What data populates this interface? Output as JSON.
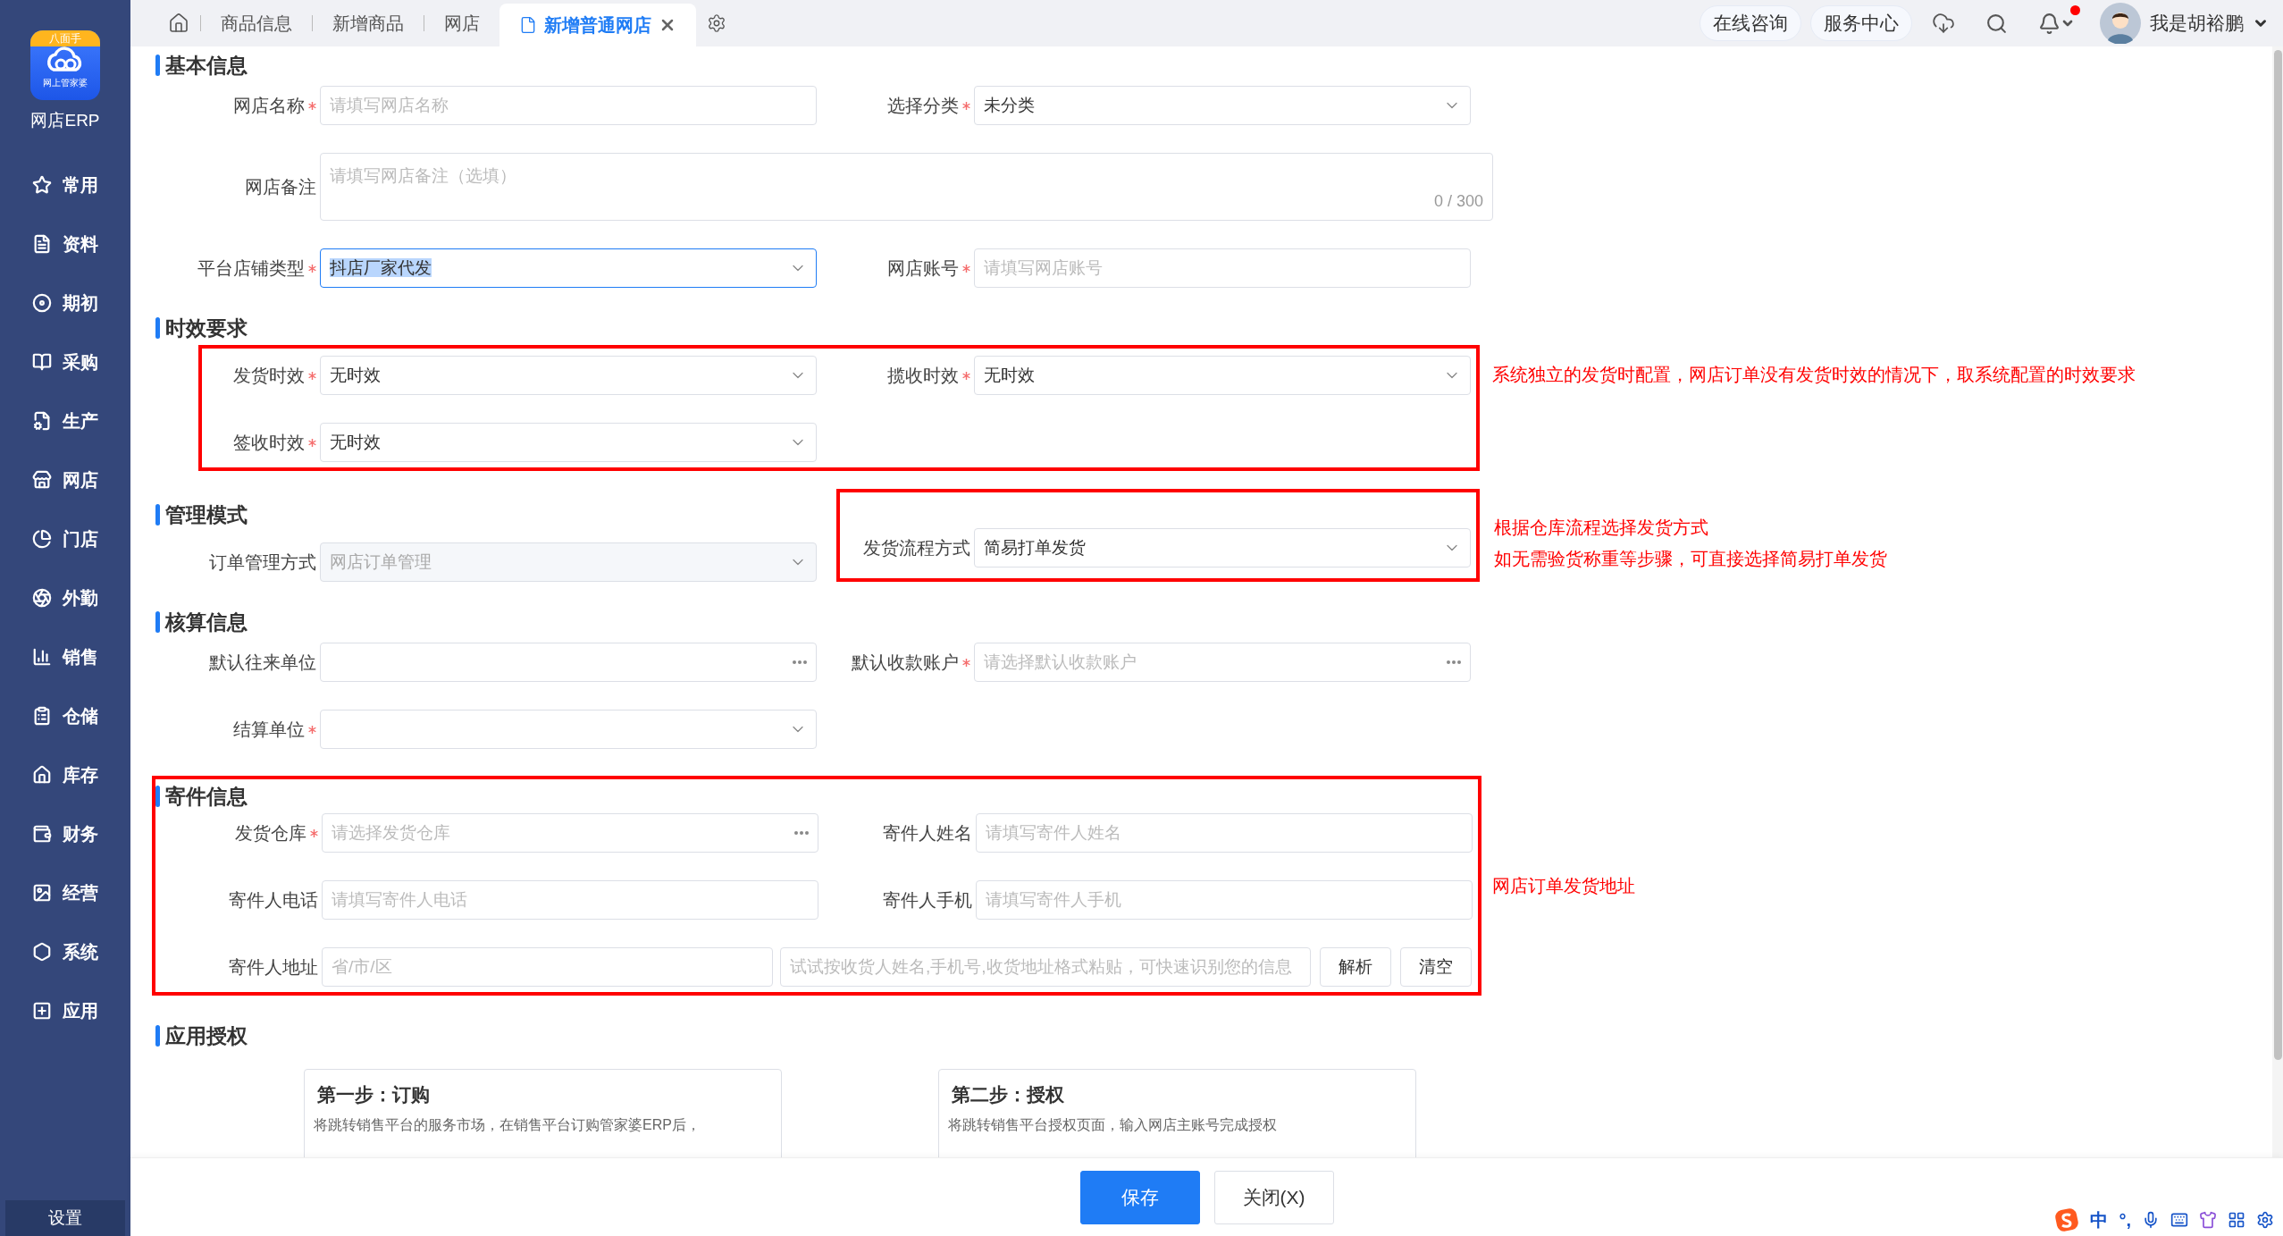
{
  "sidebar": {
    "logo": {
      "badge": "八面手",
      "caption": "网上管家婆"
    },
    "app_name": "网店ERP",
    "items": [
      {
        "label": "常用"
      },
      {
        "label": "资料"
      },
      {
        "label": "期初"
      },
      {
        "label": "采购"
      },
      {
        "label": "生产"
      },
      {
        "label": "网店"
      },
      {
        "label": "门店"
      },
      {
        "label": "外勤"
      },
      {
        "label": "销售"
      },
      {
        "label": "仓储"
      },
      {
        "label": "库存"
      },
      {
        "label": "财务"
      },
      {
        "label": "经营"
      },
      {
        "label": "系统"
      },
      {
        "label": "应用"
      }
    ],
    "footer": "设置"
  },
  "topbar": {
    "tabs": [
      {
        "label": "商品信息",
        "selected": false
      },
      {
        "label": "新增商品",
        "selected": false
      },
      {
        "label": "网店",
        "selected": false
      },
      {
        "label": "新增普通网店",
        "selected": true
      }
    ],
    "links": [
      "在线咨询",
      "服务中心"
    ],
    "has_unread": true,
    "user": "我是胡裕鹏"
  },
  "sections": [
    {
      "kind": "form",
      "title": "基本信息",
      "rows": [
        {
          "fields": [
            {
              "label": "网店名称",
              "required": true,
              "kind": "input",
              "placeholder": "请填写网店名称"
            },
            {
              "label": "选择分类",
              "required": true,
              "kind": "select",
              "value": "未分类"
            }
          ]
        },
        {
          "fields": [
            {
              "label": "网店备注",
              "required": false,
              "kind": "textarea",
              "placeholder": "请填写网店备注（选填）",
              "counter": "0 / 300"
            }
          ]
        },
        {
          "fields": [
            {
              "label": "平台店铺类型",
              "required": true,
              "kind": "select",
              "value": "抖店厂家代发",
              "focused": true
            },
            {
              "label": "网店账号",
              "required": true,
              "kind": "input",
              "placeholder": "请填写网店账号"
            }
          ]
        }
      ]
    },
    {
      "kind": "framed_rows",
      "title": "时效要求",
      "note": [
        "系统独立的发货时配置，网店订单没有发货时效的情况下，取系统配置的时效要求"
      ],
      "rows": [
        {
          "fields": [
            {
              "label": "发货时效",
              "required": true,
              "kind": "select",
              "value": "无时效"
            },
            {
              "label": "揽收时效",
              "required": true,
              "kind": "select",
              "value": "无时效"
            }
          ]
        },
        {
          "fields": [
            {
              "label": "签收时效",
              "required": true,
              "kind": "select",
              "value": "无时效"
            }
          ]
        }
      ]
    },
    {
      "kind": "framed_right",
      "title": "管理模式",
      "note": [
        "根据仓库流程选择发货方式",
        "如无需验货称重等步骤，可直接选择简易打单发货"
      ],
      "rows": [
        {
          "fields": [
            {
              "label": "订单管理方式",
              "required": false,
              "kind": "select",
              "value": "网店订单管理",
              "disabled": true
            },
            {
              "label": "发货流程方式",
              "required": false,
              "kind": "select",
              "value": "简易打单发货"
            }
          ]
        }
      ]
    },
    {
      "kind": "form",
      "title": "核算信息",
      "rows": [
        {
          "fields": [
            {
              "label": "默认往来单位",
              "required": false,
              "kind": "picker"
            },
            {
              "label": "默认收款账户",
              "required": true,
              "kind": "picker",
              "placeholder": "请选择默认收款账户"
            }
          ]
        },
        {
          "fields": [
            {
              "label": "结算单位",
              "required": true,
              "kind": "select"
            }
          ]
        }
      ]
    },
    {
      "kind": "framed_section",
      "title": "寄件信息",
      "note": [
        "网店订单发货地址"
      ],
      "rows": [
        {
          "fields": [
            {
              "label": "发货仓库",
              "required": true,
              "kind": "picker",
              "placeholder": "请选择发货仓库"
            },
            {
              "label": "寄件人姓名",
              "required": false,
              "kind": "input",
              "placeholder": "请填写寄件人姓名"
            }
          ]
        },
        {
          "fields": [
            {
              "label": "寄件人电话",
              "required": false,
              "kind": "input",
              "placeholder": "请填写寄件人电话"
            },
            {
              "label": "寄件人手机",
              "required": false,
              "kind": "input",
              "placeholder": "请填写寄件人手机"
            }
          ]
        },
        {
          "fields": [
            {
              "label": "寄件人地址",
              "required": false,
              "kind": "address",
              "region_placeholder": "省/市/区",
              "placeholder": "试试按收货人姓名,手机号,收货地址格式粘贴，可快速识别您的信息",
              "buttons": [
                "解析",
                "清空"
              ]
            }
          ]
        }
      ]
    },
    {
      "kind": "cards",
      "title": "应用授权",
      "cards": [
        {
          "title": "第一步：订购",
          "text": "将跳转销售平台的服务市场，在销售平台订购管家婆ERP后，"
        },
        {
          "title": "第二步：授权",
          "text": "将跳转销售平台授权页面，输入网店主账号完成授权"
        }
      ]
    }
  ],
  "footer": {
    "buttons": [
      {
        "label": "保存",
        "kind": "primary"
      },
      {
        "label": "关闭(X)",
        "kind": "default"
      }
    ]
  },
  "ime": {
    "labels": [
      "中",
      "°,"
    ]
  }
}
